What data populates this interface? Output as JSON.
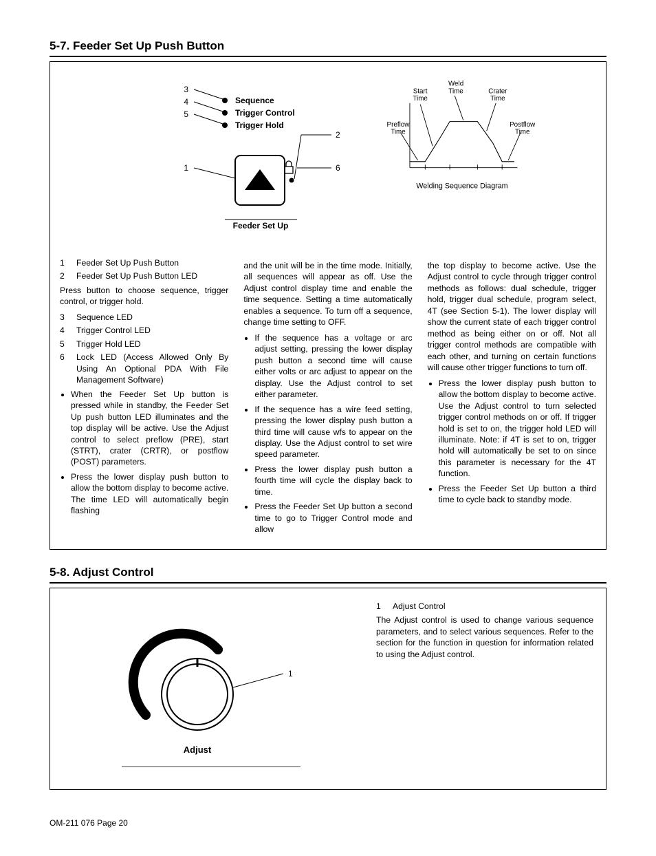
{
  "section57": {
    "heading": "5-7.   Feeder Set Up Push Button",
    "panel_labels": {
      "sequence": "Sequence",
      "trigger_control": "Trigger Control",
      "trigger_hold": "Trigger Hold",
      "caption": "Feeder Set Up",
      "callouts": {
        "1": "1",
        "2": "2",
        "3": "3",
        "4": "4",
        "5": "5",
        "6": "6"
      }
    },
    "weld_diagram": {
      "preflow": "Preflow\nTime",
      "start": "Start\nTime",
      "weld": "Weld\nTime",
      "crater": "Crater\nTime",
      "postflow": "Postflow\nTime",
      "caption": "Welding Sequence Diagram"
    },
    "legend": [
      {
        "n": "1",
        "t": "Feeder Set Up Push Button"
      },
      {
        "n": "2",
        "t": "Feeder Set Up Push Button LED"
      }
    ],
    "intro": "Press button to choose sequence, trigger control, or trigger hold.",
    "legend2": [
      {
        "n": "3",
        "t": "Sequence LED"
      },
      {
        "n": "4",
        "t": "Trigger Control LED"
      },
      {
        "n": "5",
        "t": "Trigger Hold LED"
      },
      {
        "n": "6",
        "t": "Lock LED (Access Allowed Only By Using An Optional PDA With File Management Software)"
      }
    ],
    "col1_bullets": [
      "When the Feeder Set Up button is pressed while in standby, the Feeder Set Up push button LED illuminates and the top display will be active. Use the Adjust control to select preflow (PRE), start (STRT), crater (CRTR), or postflow (POST) parameters.",
      "Press the lower display push button to allow the bottom display to become active. The time LED will automatically begin flashing"
    ],
    "col2_first": "and the unit will be in the time mode. Initially, all sequences will appear as off. Use the Adjust control display time and enable the time sequence. Setting a time automatically enables a sequence. To turn off a sequence, change time setting to OFF.",
    "col2_bullets": [
      "If the sequence has a voltage or arc adjust setting, pressing the lower display push button a second time will cause either volts or arc adjust to appear on the display. Use the Adjust control to set either parameter.",
      "If the sequence has a wire feed setting, pressing the lower display push button a third time will cause wfs to appear on the display. Use the Adjust control to set wire speed parameter.",
      "Press the lower display push button a fourth time will cycle the display back to time.",
      "Press the Feeder Set Up button a second time to go to Trigger Control mode and allow"
    ],
    "col3_first": "the top display to become active. Use the Adjust control to cycle through trigger control methods as follows: dual schedule, trigger hold, trigger dual schedule, program select, 4T (see Section 5-1). The lower display will show the current state of each trigger control method as being either on or off. Not all trigger control methods are compatible with each other, and turning on certain functions will cause other trigger functions to turn off.",
    "col3_bullets": [
      "Press the lower display push button to allow the bottom display to become active. Use the Adjust control to turn selected trigger control methods on or off. If trigger hold is set to on, the trigger hold LED will illuminate. Note: if 4T is set to on, trigger hold will automatically be set to on since this parameter is necessary for the 4T function.",
      "Press the Feeder Set Up button a third time to cycle back to standby mode."
    ]
  },
  "section58": {
    "heading": "5-8.   Adjust Control",
    "callout_1": "1",
    "caption": "Adjust",
    "legend_n": "1",
    "legend_t": "Adjust Control",
    "body": "The Adjust control is used to change various sequence parameters, and to select various sequences. Refer to the section for the function in question for information related to using the Adjust control."
  },
  "footer": "OM-211 076 Page 20"
}
